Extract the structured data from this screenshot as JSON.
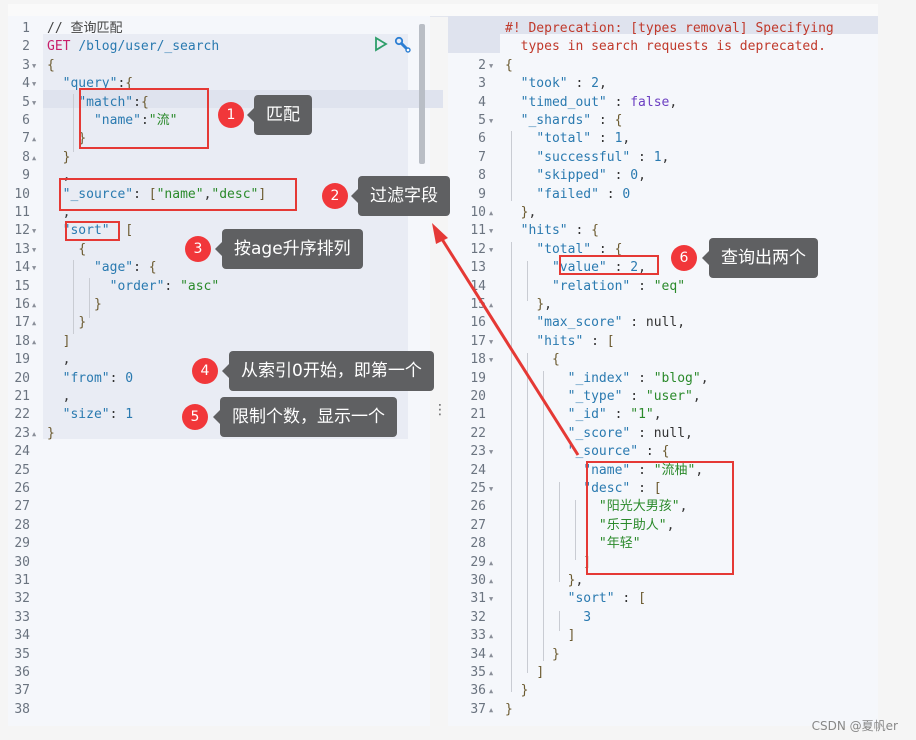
{
  "left_editor": {
    "lines": [
      {
        "n": "1",
        "fold": "",
        "html": "<span class='c'>// 查询匹配</span>"
      },
      {
        "n": "2",
        "fold": "",
        "html": "<span class='m'>GET</span> <span class='k'>/blog/user/_search</span>"
      },
      {
        "n": "3",
        "fold": "▼",
        "html": "<span class='b'>{</span>"
      },
      {
        "n": "4",
        "fold": "▼",
        "html": "  <span class='k'>\"query\"</span>:<span class='b'>{</span>"
      },
      {
        "n": "5",
        "fold": "▼",
        "html": "    <span class='k'>\"match\"</span>:<span class='b'>{</span>"
      },
      {
        "n": "6",
        "fold": "",
        "html": "      <span class='k'>\"name\"</span>:<span class='s'>\"流\"</span>"
      },
      {
        "n": "7",
        "fold": "▲",
        "html": "    <span class='b'>}</span>"
      },
      {
        "n": "8",
        "fold": "▲",
        "html": "  <span class='b'>}</span>"
      },
      {
        "n": "9",
        "fold": "",
        "html": "  ,"
      },
      {
        "n": "10",
        "fold": "",
        "html": "  <span class='k'>\"_source\"</span>: <span class='b'>[</span><span class='s'>\"name\"</span>,<span class='s'>\"desc\"</span><span class='b'>]</span>"
      },
      {
        "n": "11",
        "fold": "",
        "html": "  ,"
      },
      {
        "n": "12",
        "fold": "▼",
        "html": "  <span class='k'>\"sort\"</span>  <span class='b'>[</span>"
      },
      {
        "n": "13",
        "fold": "▼",
        "html": "    <span class='b'>{</span>"
      },
      {
        "n": "14",
        "fold": "▼",
        "html": "      <span class='k'>\"age\"</span>: <span class='b'>{</span>"
      },
      {
        "n": "15",
        "fold": "",
        "html": "        <span class='k'>\"order\"</span>: <span class='s'>\"asc\"</span>"
      },
      {
        "n": "16",
        "fold": "▲",
        "html": "      <span class='b'>}</span>"
      },
      {
        "n": "17",
        "fold": "▲",
        "html": "    <span class='b'>}</span>"
      },
      {
        "n": "18",
        "fold": "▲",
        "html": "  <span class='b'>]</span>"
      },
      {
        "n": "19",
        "fold": "",
        "html": "  ,"
      },
      {
        "n": "20",
        "fold": "",
        "html": "  <span class='k'>\"from\"</span>: <span class='n'>0</span>"
      },
      {
        "n": "21",
        "fold": "",
        "html": "  ,"
      },
      {
        "n": "22",
        "fold": "",
        "html": "  <span class='k'>\"size\"</span>: <span class='n'>1</span>"
      },
      {
        "n": "23",
        "fold": "▲",
        "html": "<span class='b'>}</span>"
      },
      {
        "n": "24",
        "fold": "",
        "html": ""
      },
      {
        "n": "25",
        "fold": "",
        "html": ""
      },
      {
        "n": "26",
        "fold": "",
        "html": ""
      },
      {
        "n": "27",
        "fold": "",
        "html": ""
      },
      {
        "n": "28",
        "fold": "",
        "html": ""
      },
      {
        "n": "29",
        "fold": "",
        "html": ""
      },
      {
        "n": "30",
        "fold": "",
        "html": ""
      },
      {
        "n": "31",
        "fold": "",
        "html": ""
      },
      {
        "n": "32",
        "fold": "",
        "html": ""
      },
      {
        "n": "33",
        "fold": "",
        "html": ""
      },
      {
        "n": "34",
        "fold": "",
        "html": ""
      },
      {
        "n": "35",
        "fold": "",
        "html": ""
      },
      {
        "n": "36",
        "fold": "",
        "html": ""
      },
      {
        "n": "37",
        "fold": "",
        "html": ""
      },
      {
        "n": "38",
        "fold": "",
        "html": ""
      }
    ]
  },
  "right_editor": {
    "lines": [
      {
        "n": "1",
        "fold": "",
        "html": "<span class='err'>#! Deprecation: [types removal] Specifying</span>"
      },
      {
        "n": "",
        "fold": "",
        "html": "<span class='err'>  types in search requests is deprecated.</span>"
      },
      {
        "n": "2",
        "fold": "▼",
        "html": "<span class='b'>{</span>"
      },
      {
        "n": "3",
        "fold": "",
        "html": "  <span class='k'>\"took\"</span> : <span class='n'>2</span>,"
      },
      {
        "n": "4",
        "fold": "",
        "html": "  <span class='k'>\"timed_out\"</span> : <span class='kw'>false</span>,"
      },
      {
        "n": "5",
        "fold": "▼",
        "html": "  <span class='k'>\"_shards\"</span> : <span class='b'>{</span>"
      },
      {
        "n": "6",
        "fold": "",
        "html": "    <span class='k'>\"total\"</span> : <span class='n'>1</span>,"
      },
      {
        "n": "7",
        "fold": "",
        "html": "    <span class='k'>\"successful\"</span> : <span class='n'>1</span>,"
      },
      {
        "n": "8",
        "fold": "",
        "html": "    <span class='k'>\"skipped\"</span> : <span class='n'>0</span>,"
      },
      {
        "n": "9",
        "fold": "",
        "html": "    <span class='k'>\"failed\"</span> : <span class='n'>0</span>"
      },
      {
        "n": "10",
        "fold": "▲",
        "html": "  <span class='b'>}</span>,"
      },
      {
        "n": "11",
        "fold": "▼",
        "html": "  <span class='k'>\"hits\"</span> : <span class='b'>{</span>"
      },
      {
        "n": "12",
        "fold": "▼",
        "html": "    <span class='k'>\"total\"</span> : <span class='b'>{</span>"
      },
      {
        "n": "13",
        "fold": "",
        "html": "      <span class='k'>\"value\"</span> : <span class='n'>2</span>,"
      },
      {
        "n": "14",
        "fold": "",
        "html": "      <span class='k'>\"relation\"</span> : <span class='s'>\"eq\"</span>"
      },
      {
        "n": "15",
        "fold": "▲",
        "html": "    <span class='b'>}</span>,"
      },
      {
        "n": "16",
        "fold": "",
        "html": "    <span class='k'>\"max_score\"</span> : null,"
      },
      {
        "n": "17",
        "fold": "▼",
        "html": "    <span class='k'>\"hits\"</span> : <span class='b'>[</span>"
      },
      {
        "n": "18",
        "fold": "▼",
        "html": "      <span class='b'>{</span>"
      },
      {
        "n": "19",
        "fold": "",
        "html": "        <span class='k'>\"_index\"</span> : <span class='s'>\"blog\"</span>,"
      },
      {
        "n": "20",
        "fold": "",
        "html": "        <span class='k'>\"_type\"</span> : <span class='s'>\"user\"</span>,"
      },
      {
        "n": "21",
        "fold": "",
        "html": "        <span class='k'>\"_id\"</span> : <span class='s'>\"1\"</span>,"
      },
      {
        "n": "22",
        "fold": "",
        "html": "        <span class='k'>\"_score\"</span> : null,"
      },
      {
        "n": "23",
        "fold": "▼",
        "html": "        <span class='k'>\"_source\"</span> : <span class='b'>{</span>"
      },
      {
        "n": "24",
        "fold": "",
        "html": "          <span class='k'>\"name\"</span> : <span class='s'>\"流柚\"</span>,"
      },
      {
        "n": "25",
        "fold": "▼",
        "html": "          <span class='k'>\"desc\"</span> : <span class='b'>[</span>"
      },
      {
        "n": "26",
        "fold": "",
        "html": "            <span class='s'>\"阳光大男孩\"</span>,"
      },
      {
        "n": "27",
        "fold": "",
        "html": "            <span class='s'>\"乐于助人\"</span>,"
      },
      {
        "n": "28",
        "fold": "",
        "html": "            <span class='s'>\"年轻\"</span>"
      },
      {
        "n": "29",
        "fold": "▲",
        "html": "          <span class='b'>]</span>"
      },
      {
        "n": "30",
        "fold": "▲",
        "html": "        <span class='b'>}</span>,"
      },
      {
        "n": "31",
        "fold": "▼",
        "html": "        <span class='k'>\"sort\"</span> : <span class='b'>[</span>"
      },
      {
        "n": "32",
        "fold": "",
        "html": "          <span class='n'>3</span>"
      },
      {
        "n": "33",
        "fold": "▲",
        "html": "        <span class='b'>]</span>"
      },
      {
        "n": "34",
        "fold": "▲",
        "html": "      <span class='b'>}</span>"
      },
      {
        "n": "35",
        "fold": "▲",
        "html": "    <span class='b'>]</span>"
      },
      {
        "n": "36",
        "fold": "▲",
        "html": "  <span class='b'>}</span>"
      },
      {
        "n": "37",
        "fold": "▲",
        "html": "<span class='b'>}</span>"
      }
    ]
  },
  "annotations": [
    {
      "num": "1",
      "text": "匹配"
    },
    {
      "num": "2",
      "text": "过滤字段"
    },
    {
      "num": "3",
      "text": "按age升序排列"
    },
    {
      "num": "4",
      "text": "从索引0开始，即第一个"
    },
    {
      "num": "5",
      "text": "限制个数，显示一个"
    },
    {
      "num": "6",
      "text": "查询出两个"
    }
  ],
  "watermark": "CSDN @夏帆er",
  "colors": {
    "accent_red": "#e53935",
    "badge_red": "#f1373a",
    "tooltip_bg": "#5f6062",
    "run_green": "#2e9e6a",
    "wrench_blue": "#2d7fd3"
  }
}
